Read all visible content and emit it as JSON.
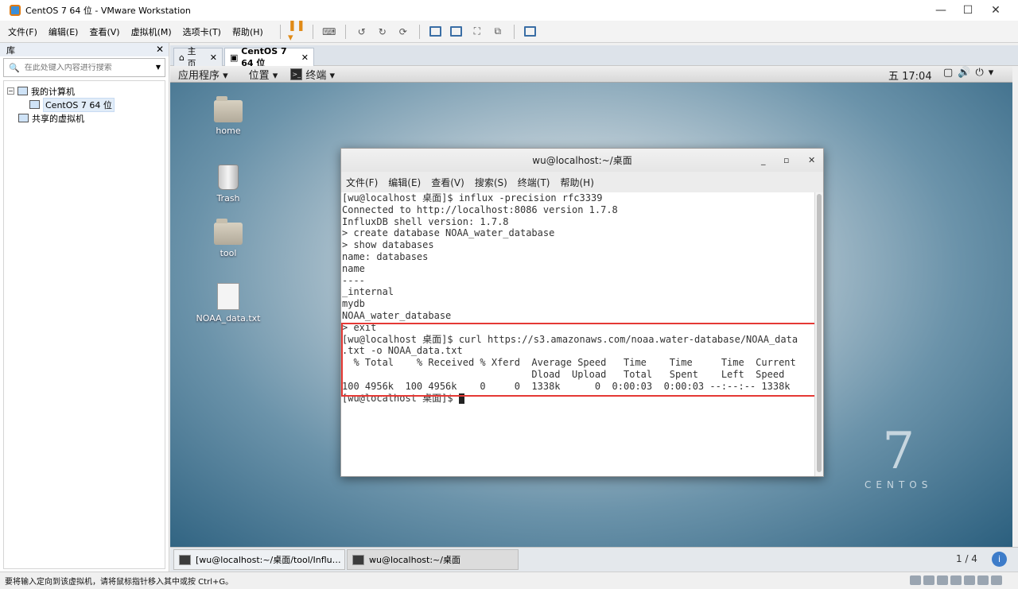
{
  "window": {
    "title": "CentOS 7 64 位 - VMware Workstation"
  },
  "menubar": {
    "items": [
      "文件(F)",
      "编辑(E)",
      "查看(V)",
      "虚拟机(M)",
      "选项卡(T)",
      "帮助(H)"
    ]
  },
  "library": {
    "title": "库",
    "search_placeholder": "在此处键入内容进行搜索",
    "tree": {
      "my_computer": "我的计算机",
      "vm": "CentOS 7 64 位",
      "shared": "共享的虚拟机"
    }
  },
  "tabs": [
    {
      "label": "主页"
    },
    {
      "label": "CentOS 7 64 位"
    }
  ],
  "guest": {
    "topbar": {
      "apps": "应用程序 ▾",
      "places": "位置 ▾",
      "terminal": "终端 ▾",
      "clock": "五 17:04"
    },
    "desktop_icons": [
      "home",
      "Trash",
      "tool",
      "NOAA_data.txt"
    ],
    "centos": {
      "seven": "7",
      "word": "CENTOS"
    }
  },
  "terminal": {
    "title": "wu@localhost:~/桌面",
    "menu": [
      "文件(F)",
      "编辑(E)",
      "查看(V)",
      "搜索(S)",
      "终端(T)",
      "帮助(H)"
    ],
    "lines": [
      "[wu@localhost 桌面]$ influx -precision rfc3339",
      "Connected to http://localhost:8086 version 1.7.8",
      "InfluxDB shell version: 1.7.8",
      "> create database NOAA_water_database",
      "> show databases",
      "name: databases",
      "name",
      "----",
      "_internal",
      "mydb",
      "NOAA_water_database",
      "> exit",
      "[wu@localhost 桌面]$ curl https://s3.amazonaws.com/noaa.water-database/NOAA_data",
      ".txt -o NOAA_data.txt",
      "  % Total    % Received % Xferd  Average Speed   Time    Time     Time  Current",
      "                                 Dload  Upload   Total   Spent    Left  Speed",
      "100 4956k  100 4956k    0     0  1338k      0  0:00:03  0:00:03 --:--:-- 1338k"
    ],
    "prompt": "[wu@localhost 桌面]$ "
  },
  "taskbar": {
    "tabs": [
      {
        "label": "[wu@localhost:~/桌面/tool/Influ…"
      },
      {
        "label": "wu@localhost:~/桌面"
      }
    ],
    "pager": "1 / 4"
  },
  "statusbar": {
    "text": "要将输入定向到该虚拟机，请将鼠标指针移入其中或按 Ctrl+G。"
  }
}
